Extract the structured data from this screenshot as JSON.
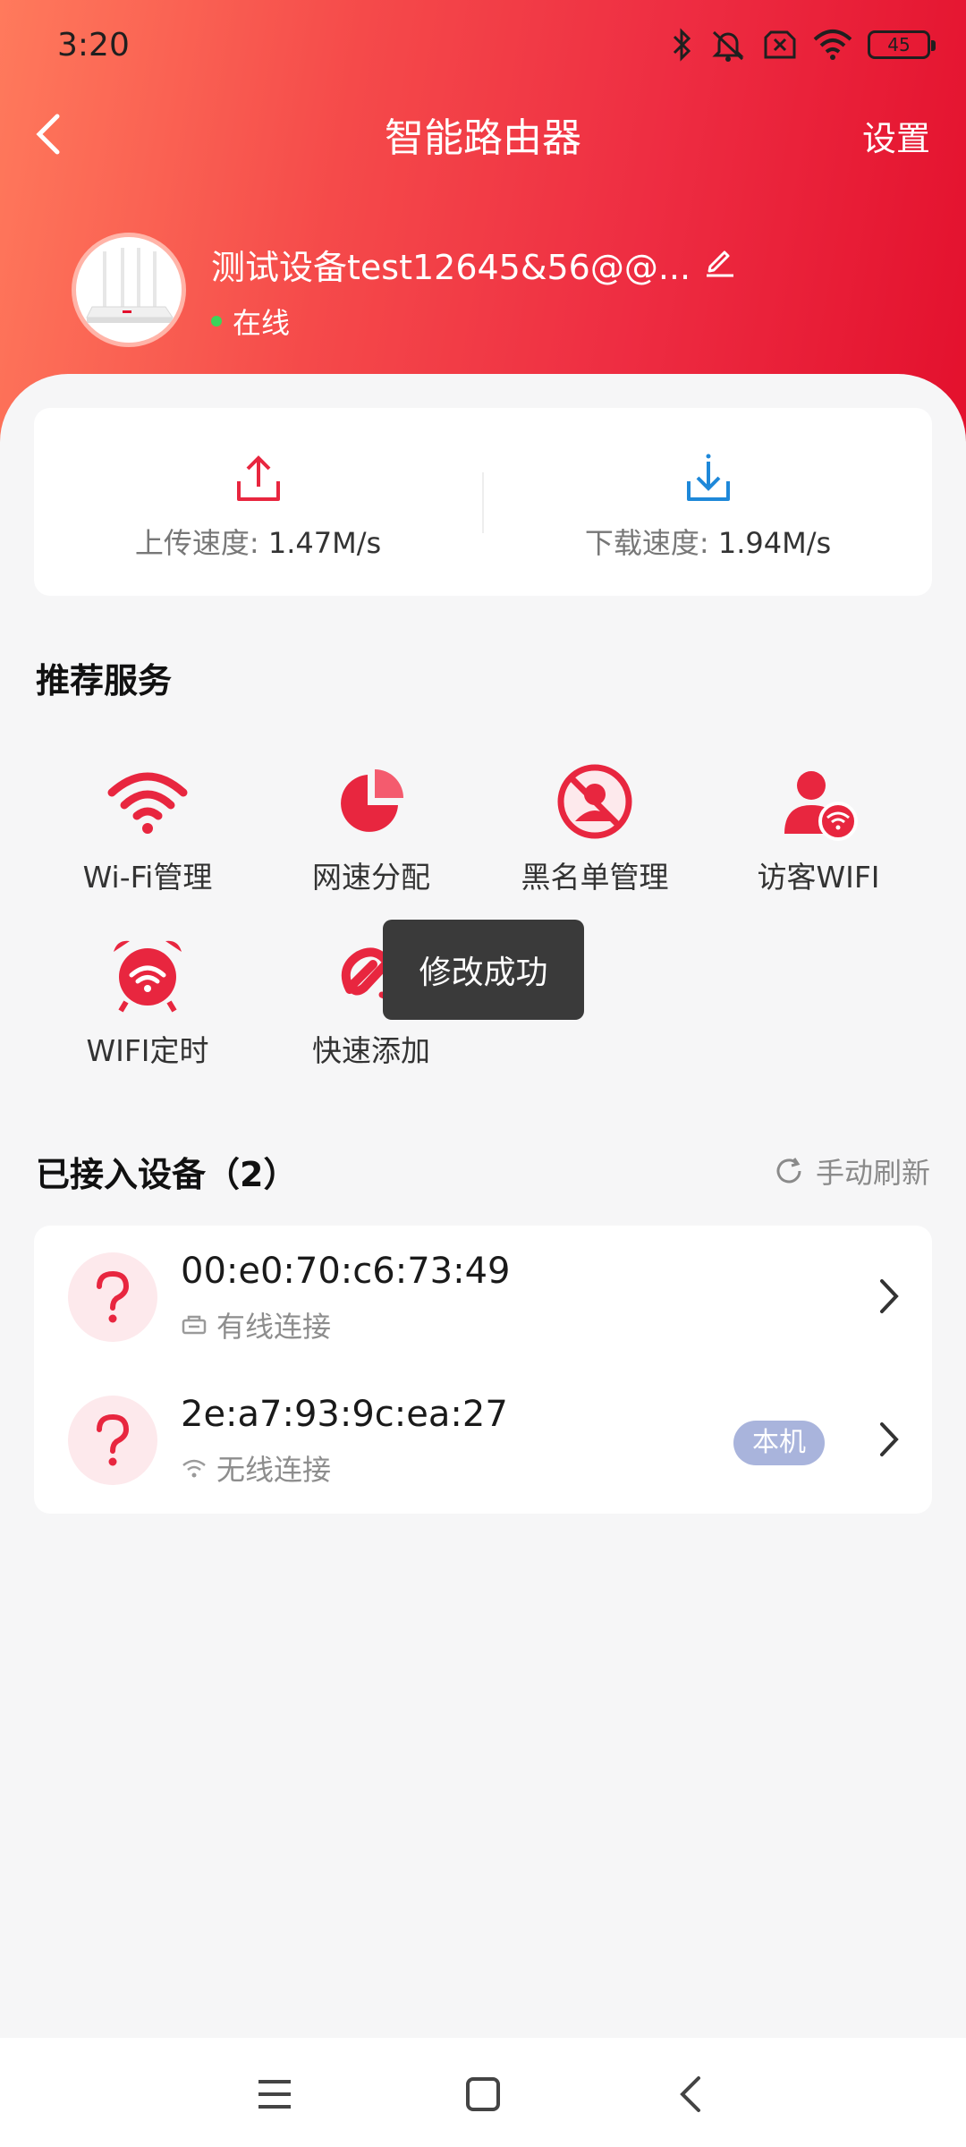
{
  "status_bar": {
    "time": "3:20",
    "battery": "45"
  },
  "nav": {
    "title": "智能路由器",
    "settings_label": "设置"
  },
  "device": {
    "name": "测试设备test12645&56@@...",
    "status": "在线"
  },
  "speed": {
    "upload_label": "上传速度:",
    "upload_value": "1.47M/s",
    "download_label": "下载速度:",
    "download_value": "1.94M/s"
  },
  "services": {
    "title": "推荐服务",
    "items": [
      {
        "label": "Wi-Fi管理",
        "icon": "wifi-icon"
      },
      {
        "label": "网速分配",
        "icon": "pie-chart-icon"
      },
      {
        "label": "黑名单管理",
        "icon": "blocked-user-icon"
      },
      {
        "label": "访客WIFI",
        "icon": "guest-wifi-icon"
      },
      {
        "label": "WIFI定时",
        "icon": "alarm-wifi-icon"
      },
      {
        "label": "快速添加",
        "icon": "quick-add-icon"
      }
    ]
  },
  "toast": {
    "message": "修改成功"
  },
  "devices": {
    "title": "已接入设备（2）",
    "refresh_label": "手动刷新",
    "items": [
      {
        "mac": "00:e0:70:c6:73:49",
        "connection": "有线连接",
        "badge": ""
      },
      {
        "mac": "2e:a7:93:9c:ea:27",
        "connection": "无线连接",
        "badge": "本机"
      }
    ]
  },
  "colors": {
    "brand_red": "#e3102d",
    "gradient_start": "#ff7a5c",
    "badge": "#a9b4dc",
    "toast_bg": "#3a3a3a"
  }
}
